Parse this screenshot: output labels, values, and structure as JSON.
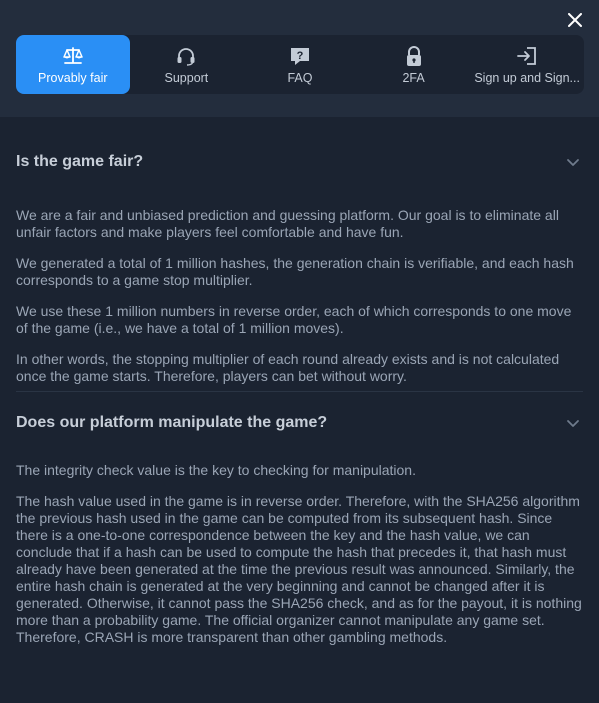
{
  "tabs": [
    {
      "label": "Provably fair",
      "icon": "scales-icon",
      "active": true
    },
    {
      "label": "Support",
      "icon": "headset-icon",
      "active": false
    },
    {
      "label": "FAQ",
      "icon": "question-bubble-icon",
      "active": false
    },
    {
      "label": "2FA",
      "icon": "lock-icon",
      "active": false
    },
    {
      "label": "Sign up and Sign...",
      "icon": "sign-in-icon",
      "active": false
    }
  ],
  "sections": [
    {
      "title": "Is the game fair?",
      "paragraphs": [
        "We are a fair and unbiased prediction and guessing platform. Our goal is to eliminate all unfair factors and make players feel comfortable and have fun.",
        "We generated a total of 1 million hashes, the generation chain is verifiable, and each hash corresponds to a game stop multiplier.",
        "We use these 1 million numbers in reverse order, each of which corresponds to one move of the game (i.e., we have a total of 1 million moves).",
        "In other words, the stopping multiplier of each round already exists and is not calculated once the game starts. Therefore, players can bet without worry."
      ]
    },
    {
      "title": "Does our platform manipulate the game?",
      "paragraphs": [
        "The integrity check value is the key to checking for manipulation.",
        "The hash value used in the game is in reverse order. Therefore, with the SHA256 algorithm the previous hash used in the game can be computed from its subsequent hash. Since there is a one-to-one correspondence between the key and the hash value, we can conclude that if a hash can be used to compute the hash that precedes it, that hash must already have been generated at the time the previous result was announced. Similarly, the entire hash chain is generated at the very beginning and cannot be changed after it is generated. Otherwise, it cannot pass the SHA256 check, and as for the payout, it is nothing more than a probability game. The official organizer cannot manipulate any game set. Therefore, CRASH is more transparent than other gambling methods."
      ]
    }
  ],
  "colors": {
    "accent": "#2a8ff5",
    "background": "#1b2331",
    "header": "#232d3d"
  }
}
